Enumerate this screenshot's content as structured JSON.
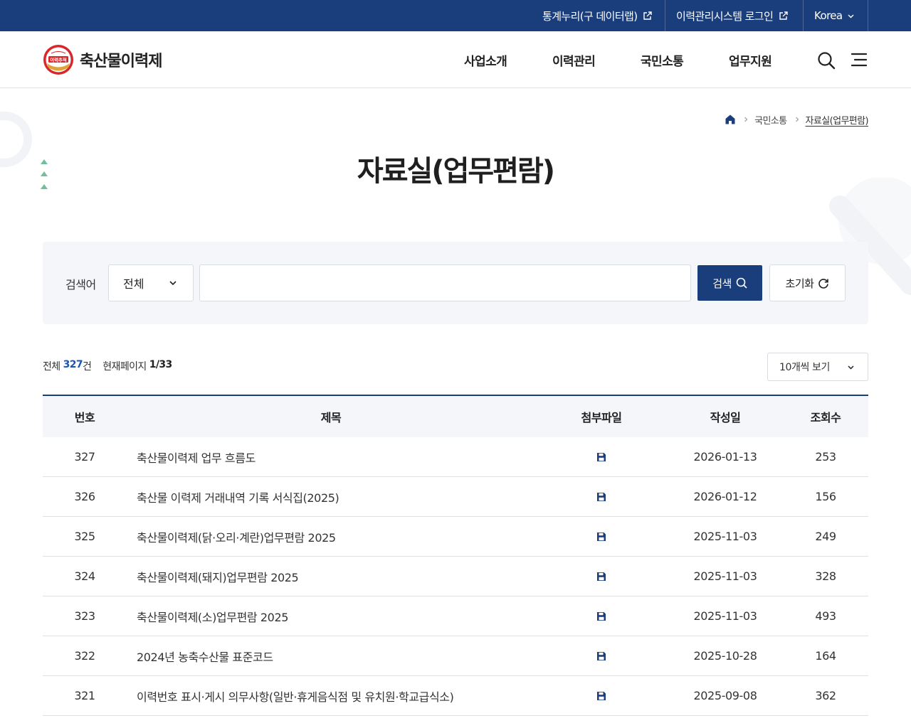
{
  "topbar": {
    "links": [
      {
        "label": "통계누리(구 데이터랩)",
        "icon": "external-link-icon"
      },
      {
        "label": "이력관리시스템 로그인",
        "icon": "external-link-icon"
      }
    ],
    "language": "Korea"
  },
  "header": {
    "logo_text": "축산물이력제",
    "logo_badge_text": "이력추적",
    "nav": [
      "사업소개",
      "이력관리",
      "국민소통",
      "업무지원"
    ]
  },
  "breadcrumb": {
    "items": [
      "국민소통",
      "자료실(업무편람)"
    ]
  },
  "page": {
    "title": "자료실(업무편람)"
  },
  "search": {
    "label": "검색어",
    "scope_selected": "전체",
    "keyword": "",
    "search_button": "검색",
    "reset_button": "초기화"
  },
  "summary": {
    "total_label": "전체",
    "total_count": "327",
    "total_suffix": "건",
    "page_label": "현재페이지",
    "page_value": "1/33",
    "per_page": "10개씩 보기"
  },
  "table": {
    "headers": [
      "번호",
      "제목",
      "첨부파일",
      "작성일",
      "조회수"
    ],
    "rows": [
      {
        "no": "327",
        "title": "축산물이력제 업무 흐름도",
        "date": "2026-01-13",
        "views": "253"
      },
      {
        "no": "326",
        "title": "축산물 이력제 거래내역 기록 서식집(2025)",
        "date": "2026-01-12",
        "views": "156"
      },
      {
        "no": "325",
        "title": "축산물이력제(닭·오리·계란)업무편람 2025",
        "date": "2025-11-03",
        "views": "249"
      },
      {
        "no": "324",
        "title": "축산물이력제(돼지)업무편람 2025",
        "date": "2025-11-03",
        "views": "328"
      },
      {
        "no": "323",
        "title": "축산물이력제(소)업무편람 2025",
        "date": "2025-11-03",
        "views": "493"
      },
      {
        "no": "322",
        "title": "2024년 농축수산물 표준코드",
        "date": "2025-10-28",
        "views": "164"
      },
      {
        "no": "321",
        "title": "이력번호 표시·게시 의무사항(일반·휴게음식점 및 유치원·학교급식소)",
        "date": "2025-09-08",
        "views": "362"
      }
    ]
  },
  "colors": {
    "primary": "#1a3d7c",
    "accent_count": "#1a56b0",
    "panel_bg": "#f4f6fa",
    "deco_green": "#6fbf9a"
  }
}
